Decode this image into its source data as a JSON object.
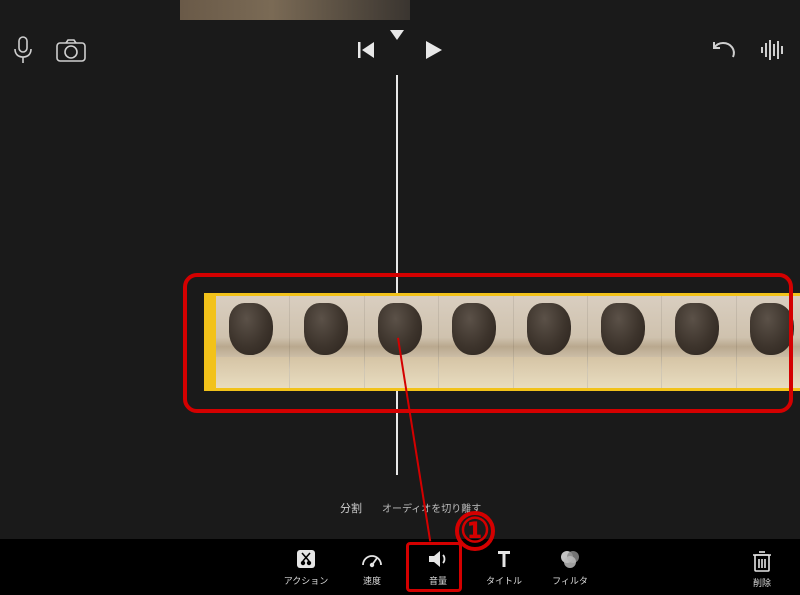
{
  "top_toolbar": {
    "icons": {
      "mic": "microphone-icon",
      "camera": "camera-icon",
      "skip_back": "skip-back-icon",
      "play": "play-icon",
      "undo": "undo-icon",
      "waveform": "waveform-icon"
    }
  },
  "timeline": {
    "clip_frame_count": 8
  },
  "strip_labels": {
    "split": "分割",
    "audio_detach": "オーディオを切り離す"
  },
  "bottom_toolbar": {
    "tools": [
      {
        "id": "action",
        "label": "アクション",
        "icon": "scissors-icon"
      },
      {
        "id": "speed",
        "label": "速度",
        "icon": "gauge-icon"
      },
      {
        "id": "volume",
        "label": "音量",
        "icon": "speaker-icon"
      },
      {
        "id": "title",
        "label": "タイトル",
        "icon": "title-icon"
      },
      {
        "id": "filter",
        "label": "フィルタ",
        "icon": "overlap-circles-icon"
      }
    ],
    "delete": {
      "label": "削除",
      "icon": "trash-icon"
    }
  },
  "annotation": {
    "number": "①",
    "color": "#d40000"
  }
}
